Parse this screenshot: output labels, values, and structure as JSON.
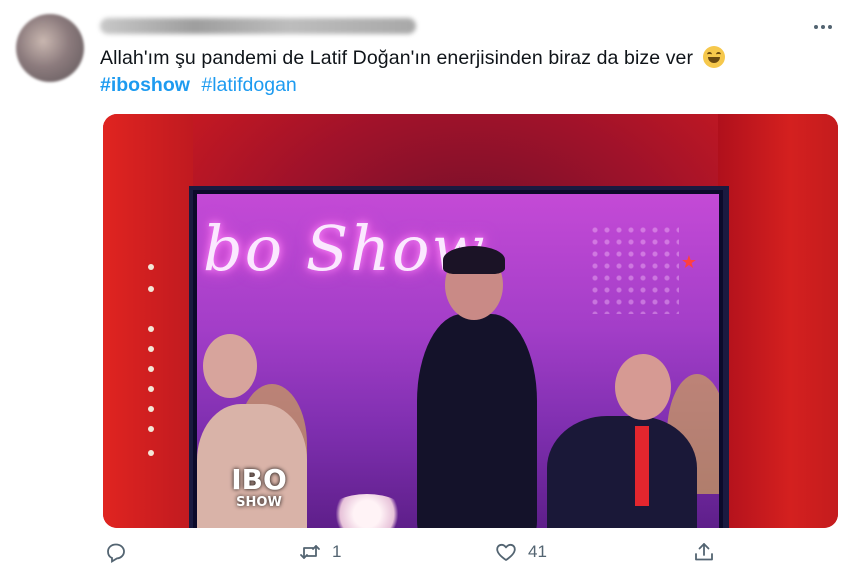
{
  "tweet": {
    "text": "Allah'ım şu pandemi de Latif Doğan'ın enerjisinden biraz da bize ver",
    "emoji": "grinning-face-with-smiling-eyes",
    "hashtags": [
      {
        "text": "#iboshow",
        "bold": true
      },
      {
        "text": "#latifdogan",
        "bold": false
      }
    ]
  },
  "media": {
    "screen_sign": "bo Show",
    "badge_line1": "IBO",
    "badge_line2": "SHOW"
  },
  "actions": {
    "reply_count": "",
    "retweet_count": "1",
    "like_count": "41",
    "share_count": ""
  },
  "colors": {
    "link": "#1d9bf0",
    "muted": "#536471",
    "text": "#0f1419"
  }
}
